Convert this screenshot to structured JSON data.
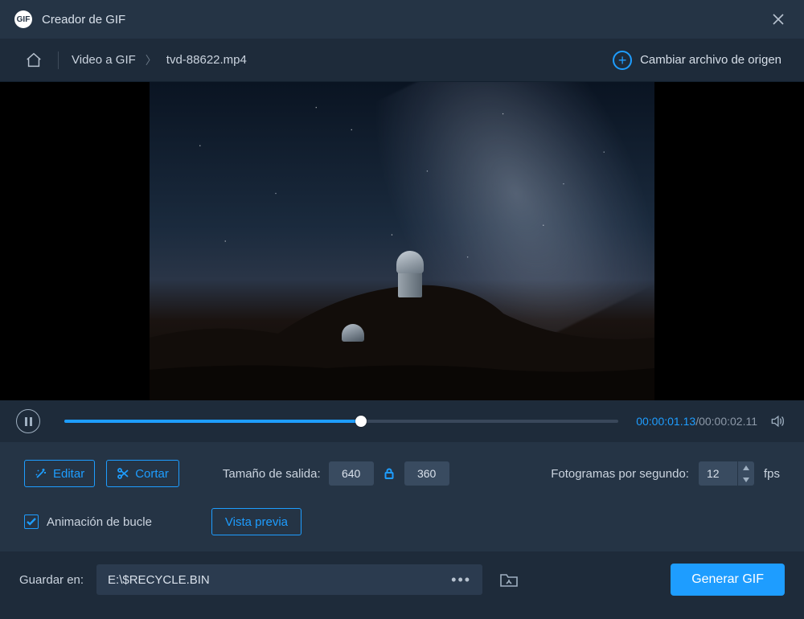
{
  "titlebar": {
    "app_name": "Creador de GIF",
    "logo_text": "GIF"
  },
  "breadcrumb": {
    "root": "Video a GIF",
    "file": "tvd-88622.mp4",
    "change_source": "Cambiar archivo de origen"
  },
  "playback": {
    "current_time": "00:00:01.13",
    "total_time": "00:00:02.11",
    "progress_percent": 53.5
  },
  "settings": {
    "edit_label": "Editar",
    "cut_label": "Cortar",
    "output_size_label": "Tamaño de salida:",
    "width": "640",
    "height": "360",
    "fps_label": "Fotogramas por segundo:",
    "fps_value": "12",
    "fps_unit": "fps",
    "loop_label": "Animación de bucle",
    "loop_checked": true,
    "preview_label": "Vista previa"
  },
  "output": {
    "save_in_label": "Guardar en:",
    "path": "E:\\$RECYCLE.BIN",
    "generate_label": "Generar GIF"
  }
}
